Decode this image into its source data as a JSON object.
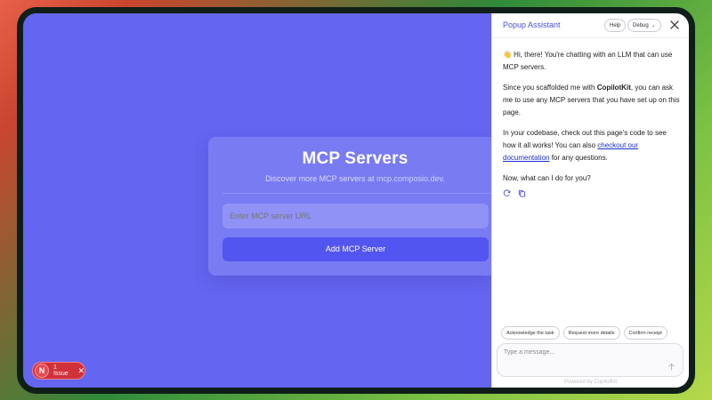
{
  "main": {
    "card": {
      "title": "MCP Servers",
      "subtitle_prefix": "Discover more MCP servers at ",
      "subtitle_link": "mcp.composio.dev.",
      "url_input_placeholder": "Enter MCP server URL",
      "add_button_label": "Add MCP Server"
    },
    "issue_badge": {
      "logo_letter": "N",
      "label": "1 Issue",
      "close_glyph": "✕"
    }
  },
  "panel": {
    "title": "Popup Assistant",
    "help_label": "Help",
    "debug_label": "Debug",
    "debug_chevron": "⌄",
    "messages": {
      "greeting": "👋 Hi, there! You're chatting with an LLM that can use MCP servers.",
      "p2_prefix": "Since you scaffolded me with ",
      "p2_bold": "CopilotKit",
      "p2_suffix": ", you can ask me to use any MCP servers that you have set up on this page.",
      "p3_prefix": "In your codebase, check out this page's code to see how it all works! You can also ",
      "p3_link": "checkout our documentation",
      "p3_suffix": " for any questions.",
      "p4": "Now, what can I do for you?"
    },
    "suggestions": [
      "Acknowledge the task",
      "Request more details",
      "Confirm receipt"
    ],
    "input_placeholder": "Type a message...",
    "powered_by": "Powered by CopilotKit"
  },
  "colors": {
    "main_bg": "#6466f1",
    "accent": "#4a4fd8",
    "button": "#5355f0",
    "issue_red": "#d0313b"
  },
  "icons": {
    "close": "close-icon",
    "regenerate": "regenerate-icon",
    "copy": "copy-icon",
    "send": "send-icon"
  }
}
